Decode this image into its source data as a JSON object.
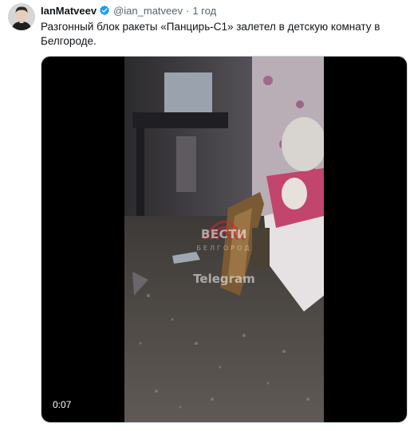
{
  "tweet": {
    "display_name": "IanMatveev",
    "handle": "@ian_matveev",
    "separator": "·",
    "time": "1 год",
    "text": "Разгонный блок ракеты «Панцирь-С1» залетел в детскую комнату в Белгороде."
  },
  "video": {
    "duration": "0:07",
    "watermark_logo": "ВЕСТИ",
    "watermark_city": "БЕЛГОРОД",
    "watermark_platform": "Telegram"
  },
  "colors": {
    "verified": "#1d9bf0",
    "text_primary": "#0f1419",
    "text_secondary": "#536471"
  }
}
